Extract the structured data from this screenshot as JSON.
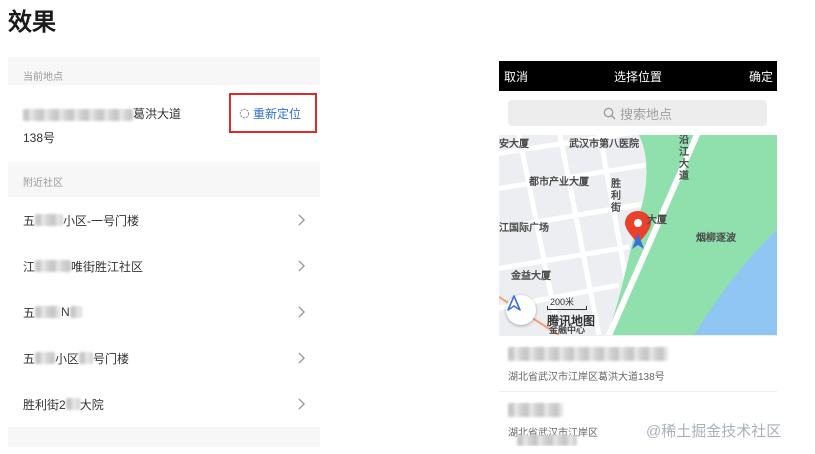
{
  "page": {
    "title": "效果"
  },
  "left": {
    "current_header": "当前地点",
    "address_visible": "葛洪大道",
    "address_line2": "138号",
    "relocate_label": "重新定位",
    "nearby_header": "附近社区",
    "communities": [
      {
        "prefix": "五",
        "suffix": "小区-一号门楼"
      },
      {
        "prefix": "江",
        "suffix": "唯街胜江社区"
      },
      {
        "prefix": "五",
        "suffix": "N"
      },
      {
        "prefix": "五",
        "suffix": "小区",
        "tail": "号门楼"
      },
      {
        "prefix": "胜利街2",
        "suffix": "大院"
      }
    ]
  },
  "phone": {
    "cancel": "取消",
    "title": "选择位置",
    "confirm": "确定",
    "search_placeholder": "搜索地点",
    "map": {
      "labels": {
        "l1": "安大厦",
        "l2": "武汉市第八医院",
        "l3": "都市产业大厦",
        "l4": "胜利街",
        "l5": "沿江大道",
        "l6": "江国际广场",
        "l7": "大厦",
        "l8": "烟柳逐波",
        "l9": "金益大厦",
        "l10": "腾讯地图",
        "l11": "金融中心"
      },
      "scale_label": "200米"
    },
    "results": [
      {
        "address": "湖北省武汉市江岸区葛洪大道138号"
      },
      {
        "address": "湖北省武汉市江岸区"
      }
    ]
  },
  "watermark": "@稀土掘金技术社区",
  "colors": {
    "accent_blue": "#2d6fd6",
    "highlight_red": "#e02a2a",
    "park_green": "#8fe0ad",
    "river_blue": "#8fc6f4",
    "pin_red": "#e8412c"
  }
}
